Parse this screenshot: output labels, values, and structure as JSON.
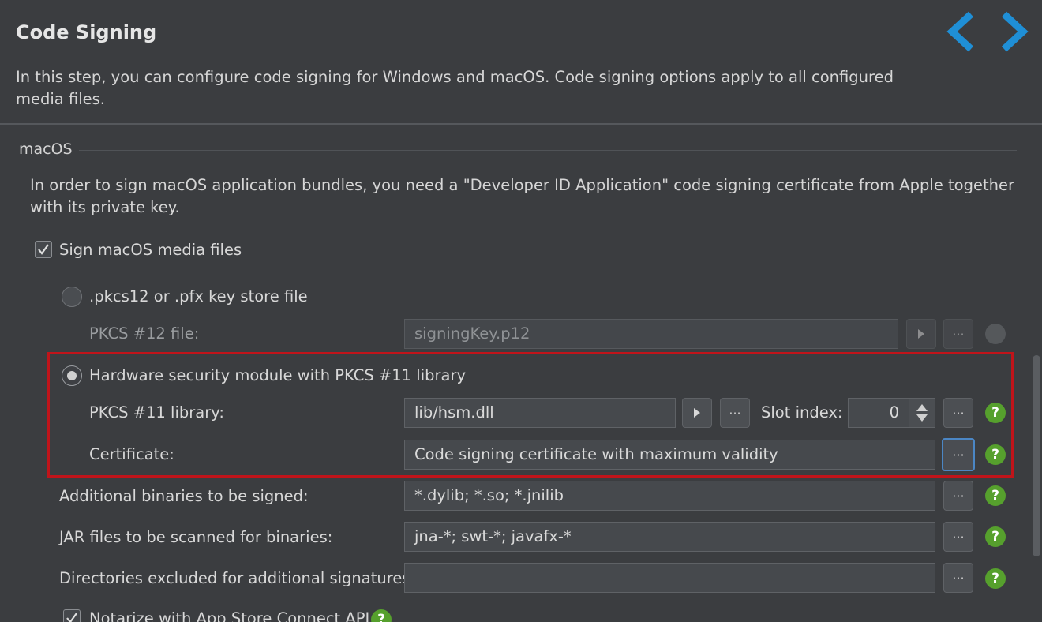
{
  "header": {
    "title": "Code Signing",
    "description": "In this step, you can configure code signing for Windows and macOS. Code signing options apply to all configured media files.",
    "nav": {
      "back_icon": "chevron-left-icon",
      "forward_icon": "chevron-right-icon",
      "accent": "#1f8fd6"
    }
  },
  "section": {
    "label": "macOS",
    "info": "In order to sign macOS application bundles, you need a \"Developer ID Application\" code signing certificate from Apple together with its private key."
  },
  "sign_checkbox": {
    "label": "Sign macOS media files",
    "checked": true
  },
  "keystore": {
    "radio_label": ".pkcs12 or .pfx key store file",
    "selected": false,
    "file_label": "PKCS #12 file:",
    "file_value": "signingKey.p12"
  },
  "hsm": {
    "radio_label": "Hardware security module with PKCS #11 library",
    "selected": true,
    "library_label": "PKCS #11 library:",
    "library_value": "lib/hsm.dll",
    "slot_label": "Slot index:",
    "slot_value": "0",
    "certificate_label": "Certificate:",
    "certificate_value": "Code signing certificate with maximum validity"
  },
  "additional": {
    "label": "Additional binaries to be signed:",
    "value": "*.dylib; *.so; *.jnilib"
  },
  "jar": {
    "label": "JAR files to be scanned for binaries:",
    "value": "jna-*; swt-*; javafx-*"
  },
  "excluded": {
    "label": "Directories excluded for additional signatures:",
    "value": ""
  },
  "notarize": {
    "label": "Notarize with App Store Connect API",
    "checked": true
  },
  "common": {
    "ellipsis": "···",
    "help": "?",
    "highlight_color": "#c0141a"
  }
}
